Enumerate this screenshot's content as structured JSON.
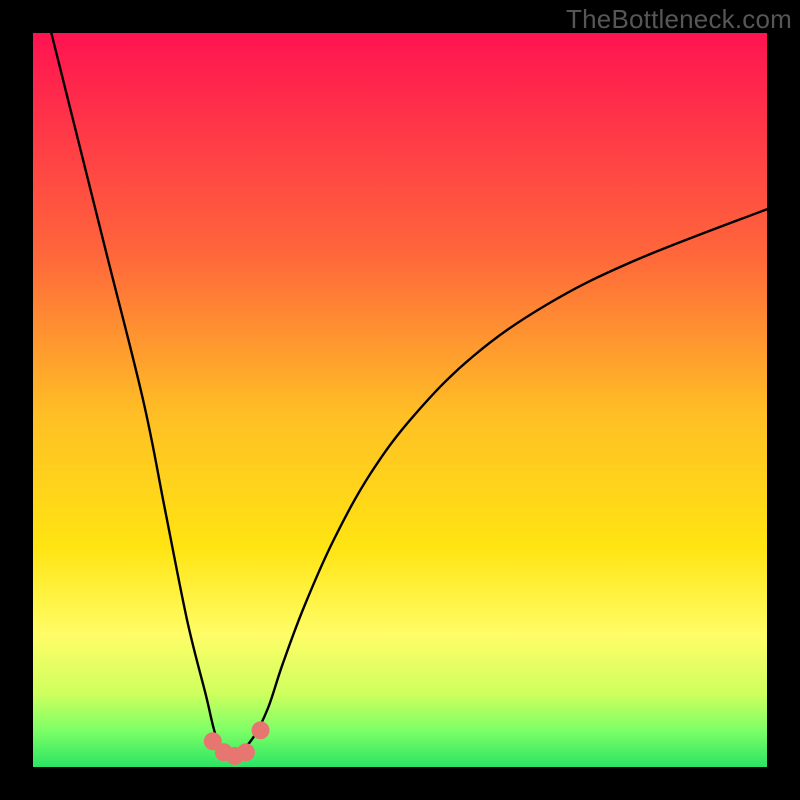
{
  "attribution": "TheBottleneck.com",
  "chart_data": {
    "type": "line",
    "title": "",
    "xlabel": "",
    "ylabel": "",
    "xlim": [
      0,
      100
    ],
    "ylim": [
      0,
      100
    ],
    "grid": false,
    "legend": false,
    "series": [
      {
        "name": "bottleneck-curve",
        "x": [
          0,
          5,
          10,
          15,
          18,
          21,
          23.5,
          25,
          26.5,
          28,
          30,
          32,
          34,
          37,
          41,
          46,
          52,
          60,
          70,
          82,
          100
        ],
        "y": [
          110,
          90,
          70,
          50,
          35,
          20,
          10,
          4,
          2,
          2,
          4,
          8,
          14,
          22,
          31,
          40,
          48,
          56,
          63,
          69,
          76
        ]
      }
    ],
    "markers": {
      "name": "bottom-basin-markers",
      "x": [
        24.5,
        26,
        27.5,
        29,
        31
      ],
      "y": [
        3.5,
        2,
        1.5,
        2,
        5
      ]
    },
    "background_gradient": {
      "direction": "top-to-bottom",
      "stops": [
        {
          "pos": 0.0,
          "color": "#ff1351"
        },
        {
          "pos": 0.3,
          "color": "#ff663b"
        },
        {
          "pos": 0.52,
          "color": "#ffbf25"
        },
        {
          "pos": 0.7,
          "color": "#ffe412"
        },
        {
          "pos": 0.82,
          "color": "#fffd67"
        },
        {
          "pos": 0.9,
          "color": "#ceff5e"
        },
        {
          "pos": 0.95,
          "color": "#7dff67"
        },
        {
          "pos": 1.0,
          "color": "#2be463"
        }
      ]
    }
  }
}
